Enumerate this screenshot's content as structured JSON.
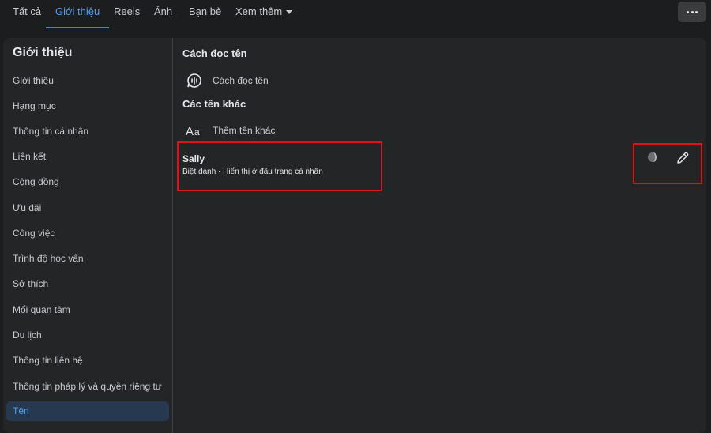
{
  "topbar": {
    "tabs": [
      {
        "label": "Tất cả"
      },
      {
        "label": "Giới thiệu",
        "active": true
      },
      {
        "label": "Reels"
      },
      {
        "label": "Ảnh"
      },
      {
        "label": "Bạn bè"
      },
      {
        "label": "Xem thêm"
      }
    ],
    "more_icon": "ellipsis-icon"
  },
  "sidebar": {
    "title": "Giới thiệu",
    "items": [
      {
        "label": "Giới thiệu"
      },
      {
        "label": "Hạng mục"
      },
      {
        "label": "Thông tin cá nhân"
      },
      {
        "label": "Liên kết"
      },
      {
        "label": "Cộng đồng"
      },
      {
        "label": "Ưu đãi"
      },
      {
        "label": "Công việc"
      },
      {
        "label": "Trình độ học vấn"
      },
      {
        "label": "Sở thích"
      },
      {
        "label": "Mối quan tâm"
      },
      {
        "label": "Du lịch"
      },
      {
        "label": "Thông tin liên hệ"
      },
      {
        "label": "Thông tin pháp lý và quyền riêng tư"
      },
      {
        "label": "Tên",
        "active": true
      }
    ]
  },
  "main": {
    "pronunciation": {
      "title": "Cách đọc tên",
      "link": "Cách đọc tên",
      "icon": "voice-bubble-icon"
    },
    "other_names": {
      "title": "Các tên khác",
      "add_link": "Thêm tên khác",
      "add_icon": "font-aa-icon",
      "entries": [
        {
          "name": "Sally",
          "description": "Biệt danh · Hiển thị ở đầu trang cá nhân"
        }
      ]
    },
    "actions": {
      "privacy_icon": "privacy-globe-icon",
      "edit_icon": "pencil-icon"
    }
  },
  "colors": {
    "accent": "#2d88ff",
    "highlight": "#d8161a",
    "card": "#242526"
  }
}
